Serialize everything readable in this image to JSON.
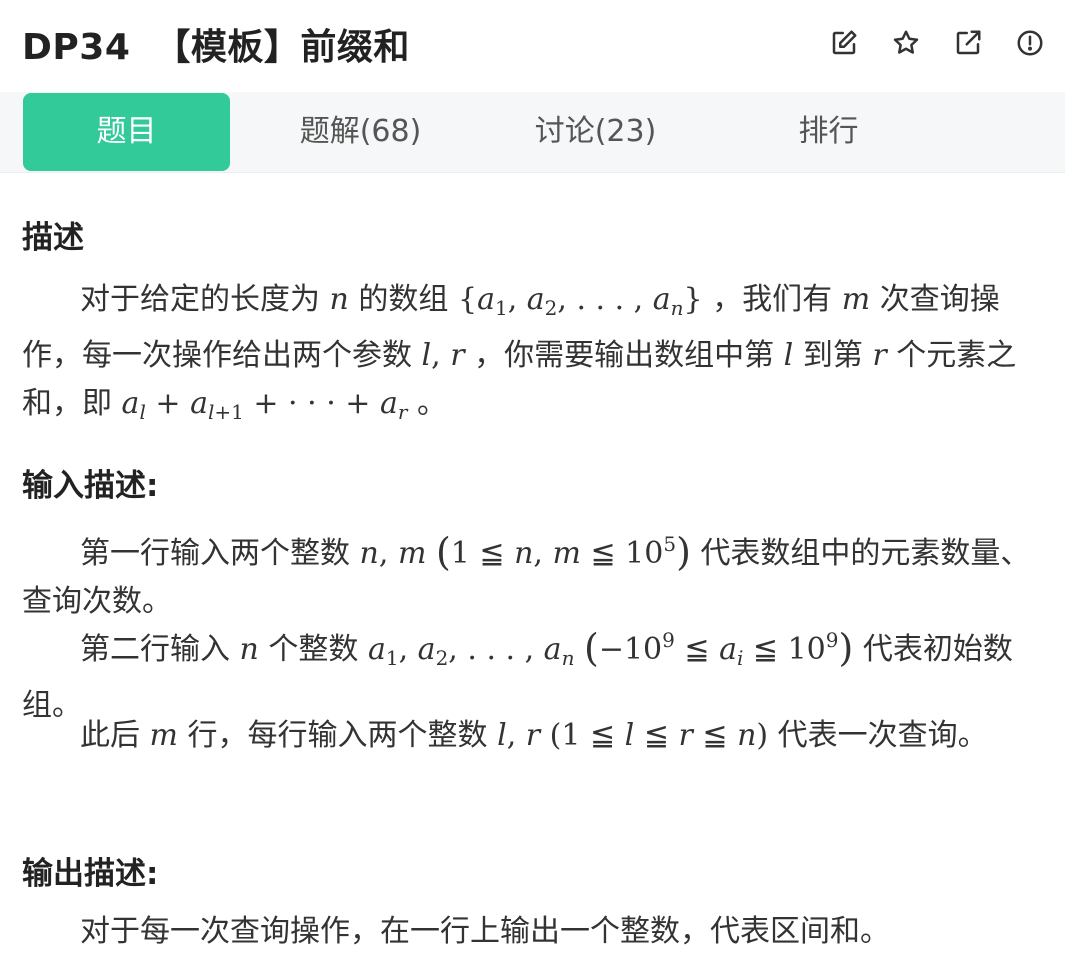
{
  "header": {
    "problem_id": "DP34",
    "problem_title": "【模板】前缀和",
    "icons": [
      "edit-icon",
      "star-icon",
      "external-link-icon",
      "report-icon"
    ]
  },
  "tabs": [
    {
      "label": "题目",
      "active": true
    },
    {
      "label": "题解(68)",
      "active": false
    },
    {
      "label": "讨论(23)",
      "active": false
    },
    {
      "label": "排行",
      "active": false
    }
  ],
  "description": {
    "heading": "描述",
    "text_1": "对于给定的长度为",
    "text_2": "的数组",
    "text_3": "，我们有",
    "text_4": "次查询操作，每一次操作给出两个参数",
    "text_5": "，你需要输出数组中第",
    "text_6": "到第",
    "text_7": "个元素之和，即",
    "text_8": "。"
  },
  "input": {
    "heading": "输入描述:",
    "line1_a": "第一行输入两个整数",
    "line1_b": "代表数组中的元素数量、查询次数。",
    "line2_a": "第二行输入",
    "line2_b": "个整数",
    "line2_c": "代表初始数组。",
    "line3_a": "此后",
    "line3_b": "行，每行输入两个整数",
    "line3_c": "代表一次查询。"
  },
  "output": {
    "heading": "输出描述:",
    "text": "对于每一次查询操作，在一行上输出一个整数，代表区间和。"
  },
  "colors": {
    "accent": "#32ca99",
    "tab_bar": "#f6f7f8",
    "text": "#333333"
  }
}
